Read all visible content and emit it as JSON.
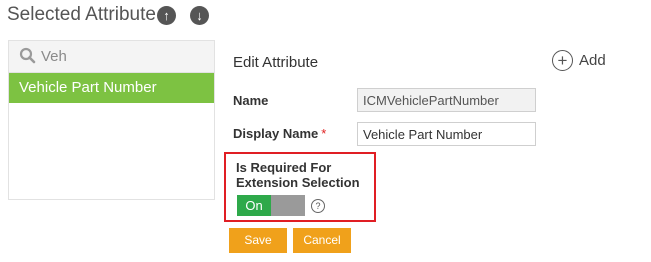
{
  "header": {
    "title": "Selected Attribute",
    "move_up_icon": "arrow-up-circle",
    "move_down_icon": "arrow-down-circle"
  },
  "attribute_list": {
    "search_value": "Veh",
    "items": [
      {
        "label": "Vehicle Part Number",
        "selected": true
      }
    ]
  },
  "form": {
    "title": "Edit  Attribute",
    "add_label": "Add",
    "name_label": "Name",
    "name_value": "ICMVehiclePartNumber",
    "display_name_label": "Display Name",
    "required_marker": "*",
    "display_name_value": "Vehicle Part Number",
    "required_for_extension_label_line1": "Is Required For",
    "required_for_extension_label_line2": "Extension Selection",
    "toggle_on_label": "On",
    "help_glyph": "?",
    "save_label": "Save",
    "cancel_label": "Cancel"
  },
  "colors": {
    "selected_item": "#7dc242",
    "toggle_on": "#2ea94a",
    "toggle_off": "#9a9a9a",
    "action_button": "#f0a11b",
    "highlight_border": "#e01e24"
  }
}
